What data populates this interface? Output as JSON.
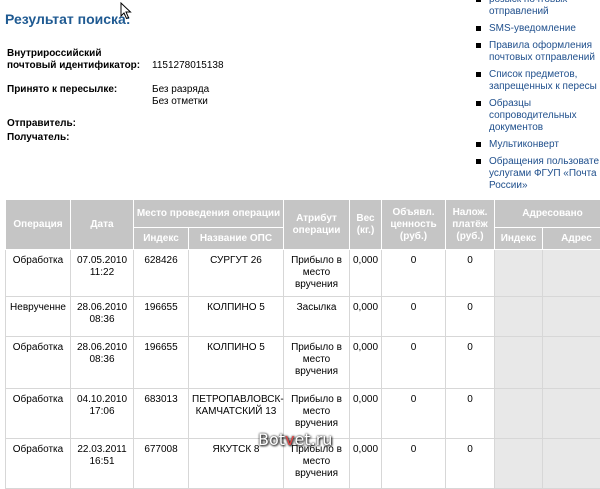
{
  "page_title": "Результат поиска:",
  "fields": {
    "tracking_label_1": "Внутрироссийский",
    "tracking_label_2": "почтовый идентификатор:",
    "tracking_value": "1151278015138",
    "accepted_label": "Принято к пересылке:",
    "accepted_value_1": "Без разряда",
    "accepted_value_2": "Без отметки",
    "sender_label": "Отправитель:",
    "recipient_label": "Получатель:"
  },
  "right_links": [
    "розыск почтовых\nотправлений",
    "SMS-уведомление",
    "Правила оформления\nпочтовых отправлений",
    "Список предметов,\nзапрещенных к пересы",
    "Образцы\nсопроводительных\nдокументов",
    "Мультиконверт",
    "Обращения пользовате\nуслугами ФГУП «Почта\nРоссии»"
  ],
  "table": {
    "headers": {
      "operation": "Операция",
      "date": "Дата",
      "place": "Место проведения операции",
      "attribute": "Атрибут операции",
      "weight": "Вес (кг.)",
      "declared_value": "Объявл. ценность (руб.)",
      "cod": "Налож. платёж (руб.)",
      "addressed": "Адресовано",
      "place_index": "Индекс",
      "place_name": "Название ОПС",
      "addr_index": "Индекс",
      "addr_address": "Адрес"
    },
    "rows": [
      [
        "Обработка",
        "07.05.2010\n11:22",
        "628426",
        "СУРГУТ 26",
        "Прибыло в\nместо\nвручения",
        "0,000",
        "0",
        "0",
        "",
        ""
      ],
      [
        "Неврученне",
        "28.06.2010\n08:36",
        "196655",
        "КОЛПИНО 5",
        "Засылка",
        "0,000",
        "0",
        "0",
        "",
        ""
      ],
      [
        "Обработка",
        "28.06.2010\n08:36",
        "196655",
        "КОЛПИНО 5",
        "Прибыло в\nместо\nвручения",
        "0,000",
        "0",
        "0",
        "",
        ""
      ],
      [
        "Обработка",
        "04.10.2010\n17:06",
        "683013",
        "ПЕТРОПАВЛОВСК-\nКАМЧАТСКИЙ 13",
        "Прибыло в\nместо\nвручения",
        "0,000",
        "0",
        "0",
        "",
        ""
      ],
      [
        "Обработка",
        "22.03.2011\n16:51",
        "677008",
        "ЯКУТСК 8",
        "Прибыло в\nместо\nвручения",
        "0,000",
        "0",
        "0",
        "",
        ""
      ]
    ]
  },
  "watermark": {
    "part1": "Bot",
    "part2": "v",
    "part3": "et.ru"
  }
}
